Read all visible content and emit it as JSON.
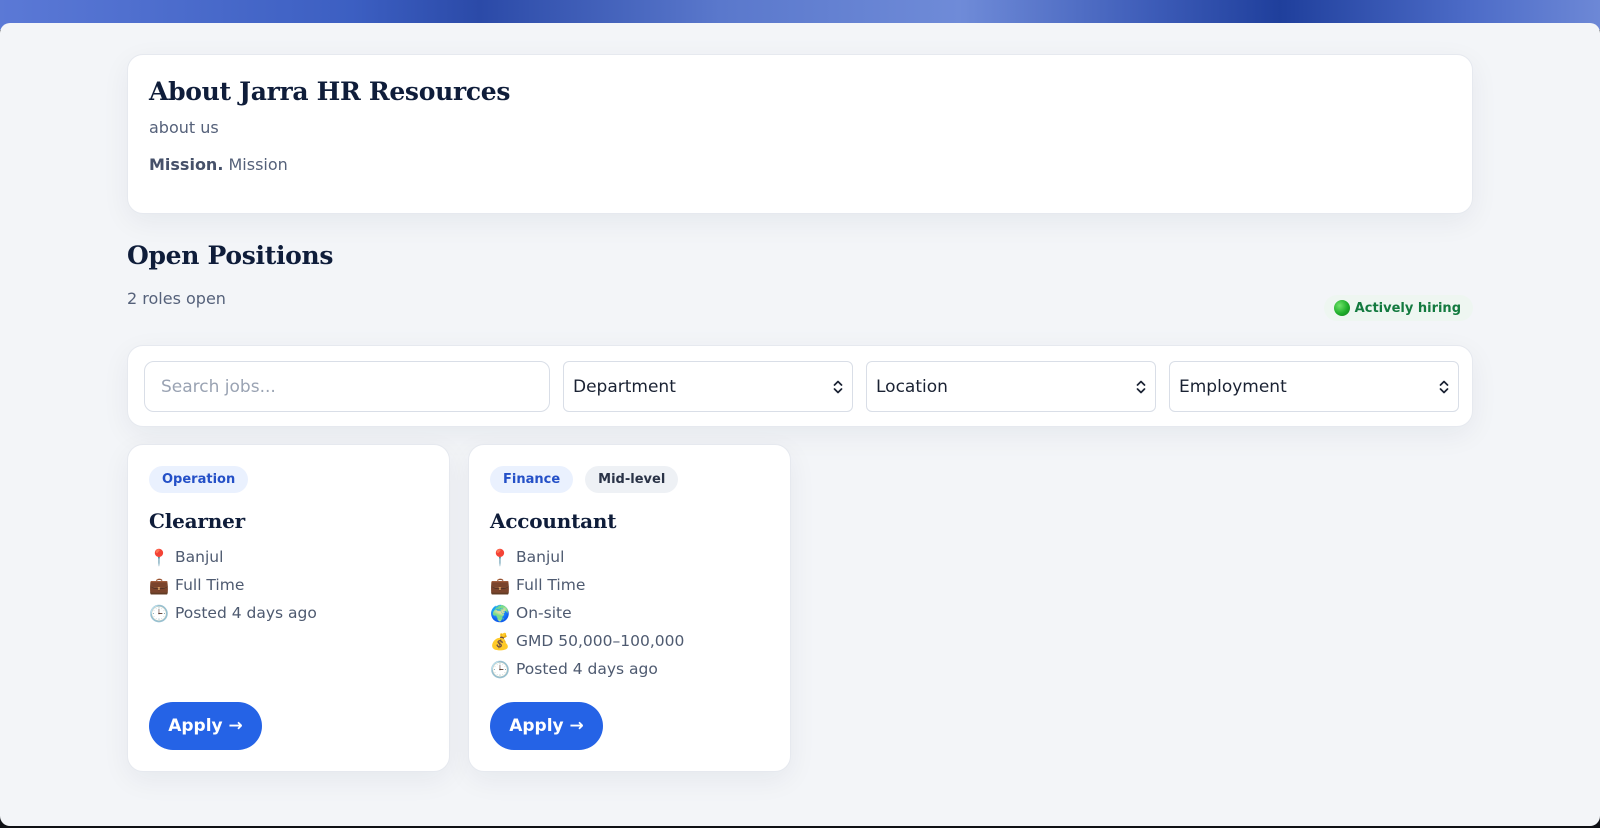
{
  "about": {
    "title": "About Jarra HR Resources",
    "text": "about us",
    "mission_label": "Mission.",
    "mission_text": "Mission"
  },
  "positions": {
    "title": "Open Positions",
    "count_text": "2 roles open",
    "status_badge": "Actively hiring"
  },
  "filters": {
    "search_placeholder": "Search jobs...",
    "department": "Department",
    "location": "Location",
    "employment": "Employment"
  },
  "jobs": [
    {
      "tags": [
        "Operation"
      ],
      "title": "Clearner",
      "meta": [
        {
          "icon": "pin-icon",
          "text": "Banjul"
        },
        {
          "icon": "briefcase-icon",
          "text": "Full Time"
        },
        {
          "icon": "clock-icon",
          "text": "Posted 4 days ago"
        }
      ],
      "apply": "Apply →"
    },
    {
      "tags": [
        "Finance",
        "Mid-level"
      ],
      "title": "Accountant",
      "meta": [
        {
          "icon": "pin-icon",
          "text": "Banjul"
        },
        {
          "icon": "briefcase-icon",
          "text": "Full Time"
        },
        {
          "icon": "globe-icon",
          "text": "On-site"
        },
        {
          "icon": "money-bag-icon",
          "text": "GMD 50,000–100,000"
        },
        {
          "icon": "clock-icon",
          "text": "Posted 4 days ago"
        }
      ],
      "apply": "Apply →"
    }
  ],
  "colors": {
    "accent": "#2563e6",
    "heading": "#0f1d3a",
    "hiring_green": "#137a3f"
  }
}
